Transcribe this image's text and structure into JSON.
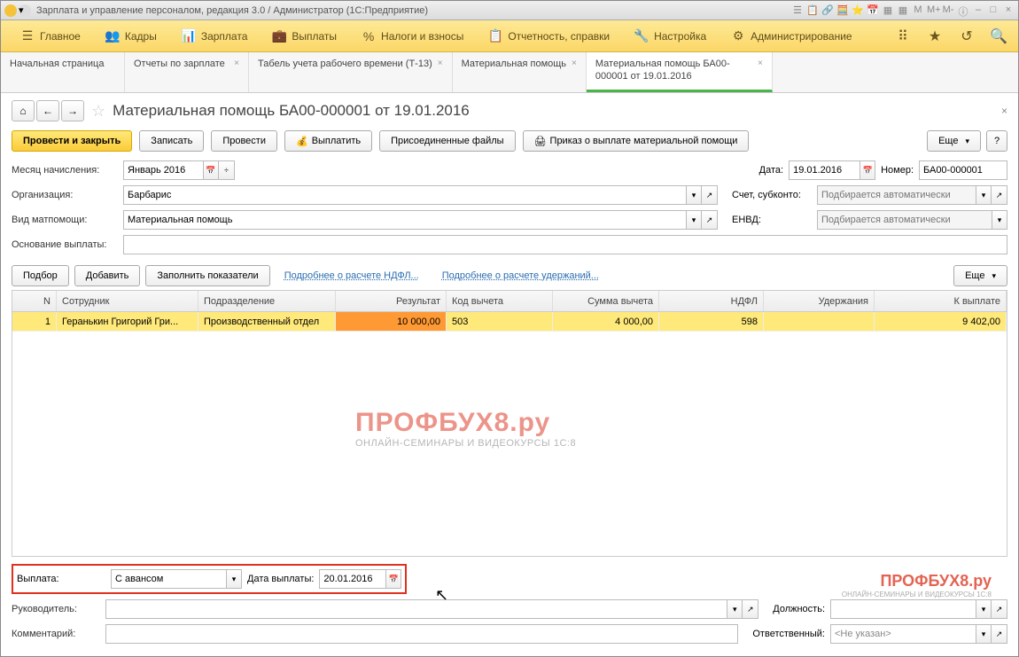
{
  "titlebar": {
    "text": "Зарплата и управление персоналом, редакция 3.0 / Администратор  (1С:Предприятие)",
    "right_labels": [
      "M",
      "M+",
      "M-"
    ]
  },
  "menu": {
    "items": [
      {
        "icon": "☰",
        "label": "Главное"
      },
      {
        "icon": "👥",
        "label": "Кадры"
      },
      {
        "icon": "📊",
        "label": "Зарплата"
      },
      {
        "icon": "💼",
        "label": "Выплаты"
      },
      {
        "icon": "%",
        "label": "Налоги и взносы"
      },
      {
        "icon": "📋",
        "label": "Отчетность, справки"
      },
      {
        "icon": "🔧",
        "label": "Настройка"
      },
      {
        "icon": "⚙",
        "label": "Администрирование"
      }
    ]
  },
  "tabs": [
    {
      "label": "Начальная страница"
    },
    {
      "label": "Отчеты по зарплате"
    },
    {
      "label": "Табель учета рабочего времени (Т-13)"
    },
    {
      "label": "Материальная помощь"
    },
    {
      "label": "Материальная помощь БА00-000001 от 19.01.2016",
      "active": true
    }
  ],
  "doc": {
    "title": "Материальная помощь БА00-000001 от 19.01.2016",
    "actions": {
      "primary": "Провести и закрыть",
      "save": "Записать",
      "post": "Провести",
      "pay": "Выплатить",
      "files": "Присоединенные файлы",
      "order": "Приказ о выплате материальной помощи",
      "more": "Еще"
    },
    "fields": {
      "month_label": "Месяц начисления:",
      "month_value": "Январь 2016",
      "date_label": "Дата:",
      "date_value": "19.01.2016",
      "number_label": "Номер:",
      "number_value": "БА00-000001",
      "org_label": "Организация:",
      "org_value": "Барбарис",
      "account_label": "Счет, субконто:",
      "account_placeholder": "Подбирается автоматически",
      "type_label": "Вид матпомощи:",
      "type_value": "Материальная помощь",
      "envd_label": "ЕНВД:",
      "envd_placeholder": "Подбирается автоматически",
      "basis_label": "Основание выплаты:"
    },
    "table_toolbar": {
      "select": "Подбор",
      "add": "Добавить",
      "fill": "Заполнить показатели",
      "link1": "Подробнее о расчете НДФЛ...",
      "link2": "Подробнее о расчете удержаний...",
      "more": "Еще"
    },
    "table": {
      "headers": {
        "n": "N",
        "emp": "Сотрудник",
        "dept": "Подразделение",
        "res": "Результат",
        "code": "Код вычета",
        "sum": "Сумма вычета",
        "ndfl": "НДФЛ",
        "hold": "Удержания",
        "pay": "К выплате"
      },
      "row": {
        "n": "1",
        "emp": "Геранькин Григорий Гри...",
        "dept": "Производственный отдел",
        "res": "10 000,00",
        "code": "503",
        "sum": "4 000,00",
        "ndfl": "598",
        "hold": "",
        "pay": "9 402,00"
      }
    },
    "payment": {
      "label": "Выплата:",
      "value": "С авансом",
      "date_label": "Дата выплаты:",
      "date_value": "20.01.2016"
    },
    "footer": {
      "manager_label": "Руководитель:",
      "position_label": "Должность:",
      "comment_label": "Комментарий:",
      "responsible_label": "Ответственный:",
      "responsible_value": "<Не указан>"
    }
  },
  "watermark": {
    "title": "ПРОФБУХ8.ру",
    "sub": "ОНЛАЙН-СЕМИНАРЫ И ВИДЕОКУРСЫ 1С:8"
  }
}
